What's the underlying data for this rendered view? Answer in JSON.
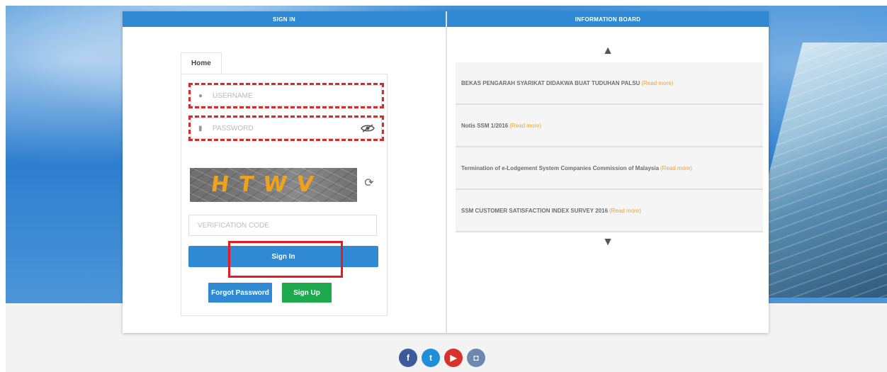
{
  "card": {
    "login_header": "SIGN IN",
    "board_header": "INFORMATION BOARD"
  },
  "tabs": [
    {
      "label": "Home"
    }
  ],
  "form": {
    "username_placeholder": "USERNAME",
    "password_placeholder": "PASSWORD",
    "captcha_text": "HTWV",
    "verification_placeholder": "VERIFICATION CODE",
    "signin_label": "Sign In",
    "forgot_label": "Forgot Password",
    "signup_label": "Sign Up"
  },
  "board": {
    "items": [
      {
        "title": "BEKAS PENGARAH SYARIKAT DIDAKWA BUAT TUDUHAN PALSU",
        "more": "(Read more)"
      },
      {
        "title": "Notis SSM 1/2016",
        "more": "(Read more)"
      },
      {
        "title": "Termination of e-Lodgement System Companies Commission of Malaysia",
        "more": "(Read more)"
      },
      {
        "title": "SSM CUSTOMER SATISFACTION INDEX SURVEY 2016",
        "more": "(Read more)"
      }
    ]
  },
  "social": [
    {
      "name": "facebook-icon",
      "glyph": "f"
    },
    {
      "name": "twitter-icon",
      "glyph": "t"
    },
    {
      "name": "youtube-icon",
      "glyph": "▶"
    },
    {
      "name": "instagram-icon",
      "glyph": "◘"
    }
  ],
  "colors": {
    "primary": "#2f8ad3",
    "success": "#1ea94e",
    "highlight": "#e31b23",
    "link": "#f0a22e"
  }
}
